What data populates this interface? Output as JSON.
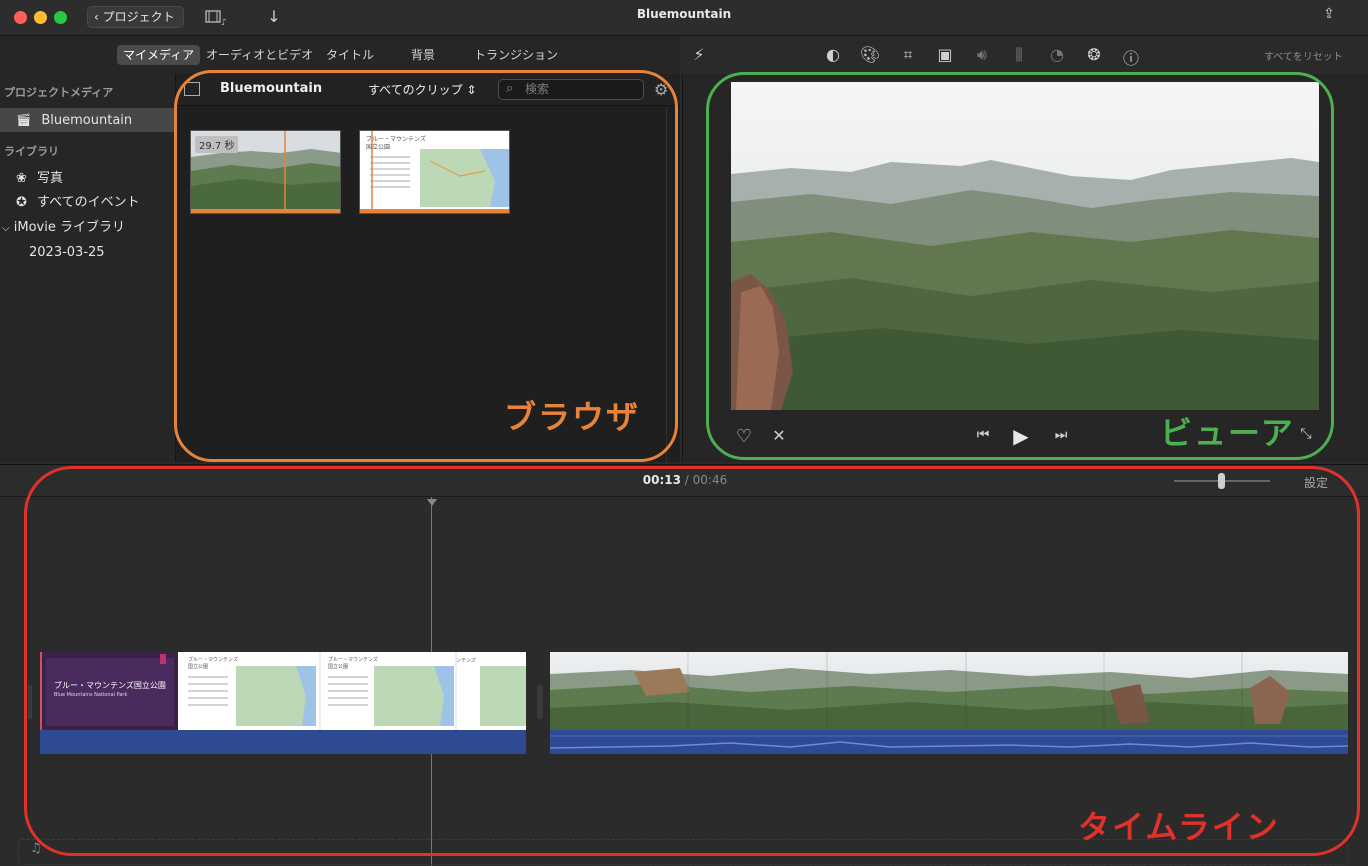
{
  "window": {
    "title": "Bluemountain",
    "back_label": "プロジェクト"
  },
  "tabs": [
    {
      "label": "マイメディア",
      "selected": true
    },
    {
      "label": "オーディオとビデオ"
    },
    {
      "label": "タイトル"
    },
    {
      "label": "背景"
    },
    {
      "label": "トランジション"
    }
  ],
  "sidebar": {
    "project_media_header": "プロジェクトメディア",
    "project_item": "Bluemountain",
    "library_header": "ライブラリ",
    "photos": "写真",
    "all_events": "すべてのイベント",
    "imovie_library": "iMovie ライブラリ",
    "event_date": "2023-03-25"
  },
  "browser": {
    "title": "Bluemountain",
    "filter": "すべてのクリップ",
    "search_placeholder": "検索",
    "clip1_duration": "29.7 秒",
    "clip2_title_line1": "ブルー・マウンテンズ",
    "clip2_title_line2": "国立公園"
  },
  "viewer_toolbar": {
    "reset_all": "すべてをリセット"
  },
  "timeline": {
    "current_time": "00:13",
    "separator": "/",
    "total_time": "00:46",
    "settings_label": "設定",
    "title_clip_main": "ブルー・マウンテンズ国立公園",
    "title_clip_sub": "Blue Mountains National Park",
    "map_clip_title": "ブルー・マウンテンズ",
    "map_clip_title2": "国立公園",
    "map_clip_title_short": "ンテンズ"
  },
  "annotations": {
    "browser": "ブラウザ",
    "viewer": "ビューア",
    "timeline": "タイムライン",
    "colors": {
      "browser": "#e8833a",
      "viewer": "#4caf50",
      "timeline": "#e0322a"
    }
  }
}
